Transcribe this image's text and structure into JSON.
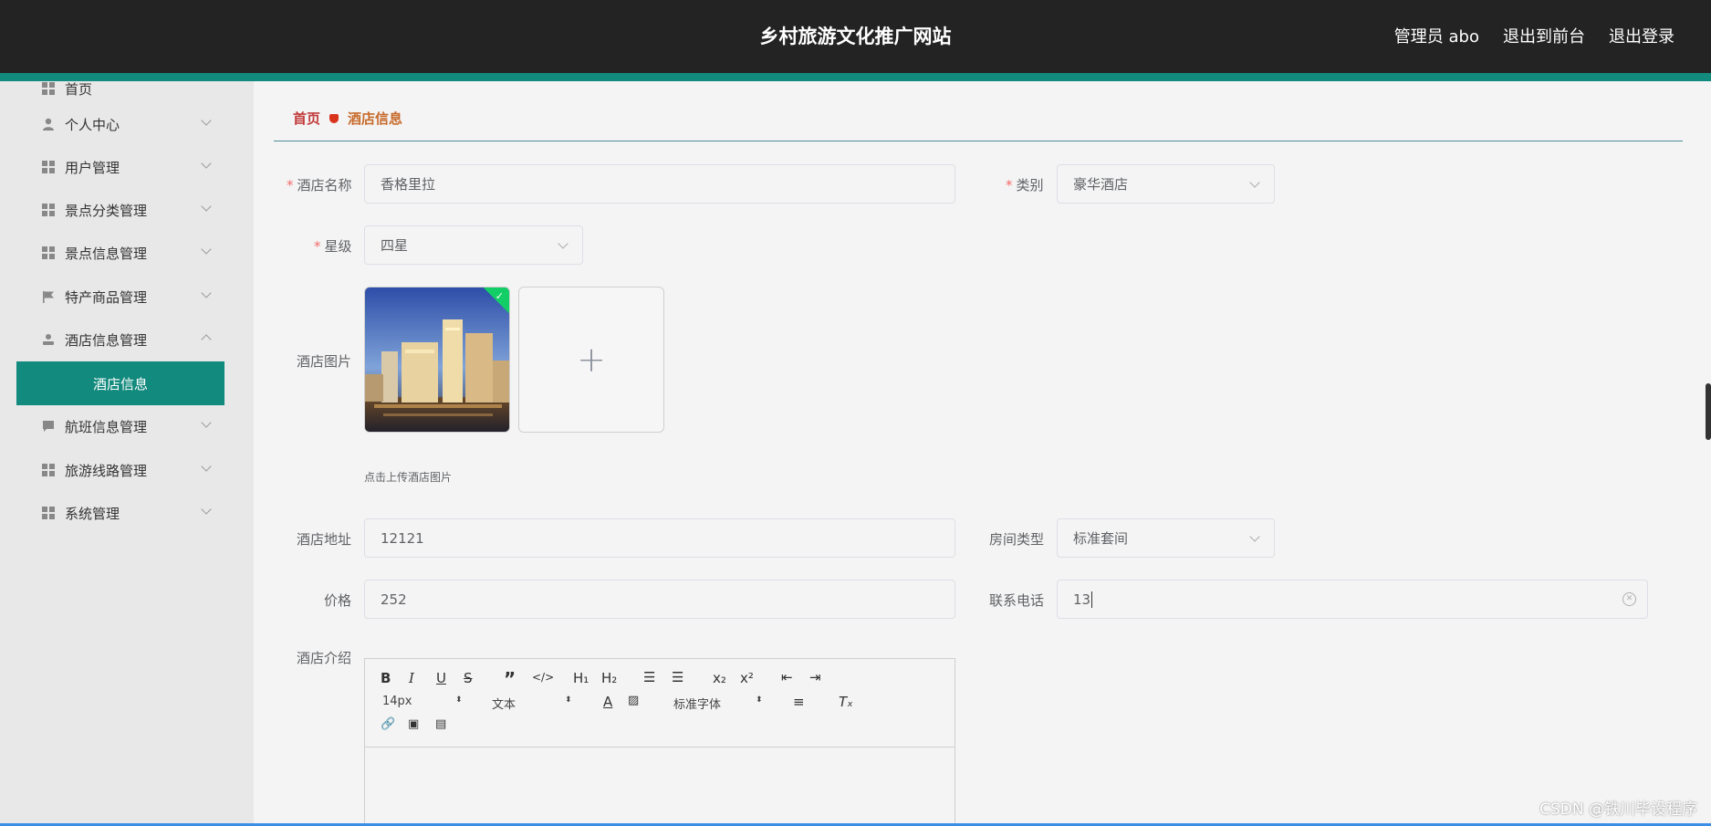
{
  "header": {
    "site_title": "乡村旅游文化推广网站",
    "admin_label": "管理员 abo",
    "back_front_label": "退出到前台",
    "logout_label": "退出登录"
  },
  "sidebar": {
    "partial_top_label": "首页",
    "items": [
      {
        "label": "个人中心",
        "icon": "user-icon"
      },
      {
        "label": "用户管理",
        "icon": "grid-icon"
      },
      {
        "label": "景点分类管理",
        "icon": "grid-icon"
      },
      {
        "label": "景点信息管理",
        "icon": "grid-icon"
      },
      {
        "label": "特产商品管理",
        "icon": "flag-icon"
      },
      {
        "label": "酒店信息管理",
        "icon": "person-icon"
      },
      {
        "label": "航班信息管理",
        "icon": "chat-icon"
      },
      {
        "label": "旅游线路管理",
        "icon": "grid-icon"
      },
      {
        "label": "系统管理",
        "icon": "grid-icon"
      }
    ],
    "active_sub_label": "酒店信息"
  },
  "breadcrumb": {
    "home": "首页",
    "current": "酒店信息"
  },
  "form": {
    "hotel_name_label": "酒店名称",
    "hotel_name_value": "香格里拉",
    "category_label": "类别",
    "category_value": "豪华酒店",
    "star_label": "星级",
    "star_value": "四星",
    "image_label": "酒店图片",
    "upload_tip": "点击上传酒店图片",
    "address_label": "酒店地址",
    "address_value": "12121",
    "room_type_label": "房间类型",
    "room_type_value": "标准套间",
    "price_label": "价格",
    "price_value": "252",
    "phone_label": "联系电话",
    "phone_value": "13",
    "intro_label": "酒店介绍"
  },
  "editor": {
    "font_size": "14px",
    "header_select": "文本",
    "font_family": "标准字体"
  },
  "watermark": "CSDN @铁川毕设程序",
  "colors": {
    "accent": "#128a7d",
    "header_bg": "#232323",
    "required": "#f56c6c"
  }
}
